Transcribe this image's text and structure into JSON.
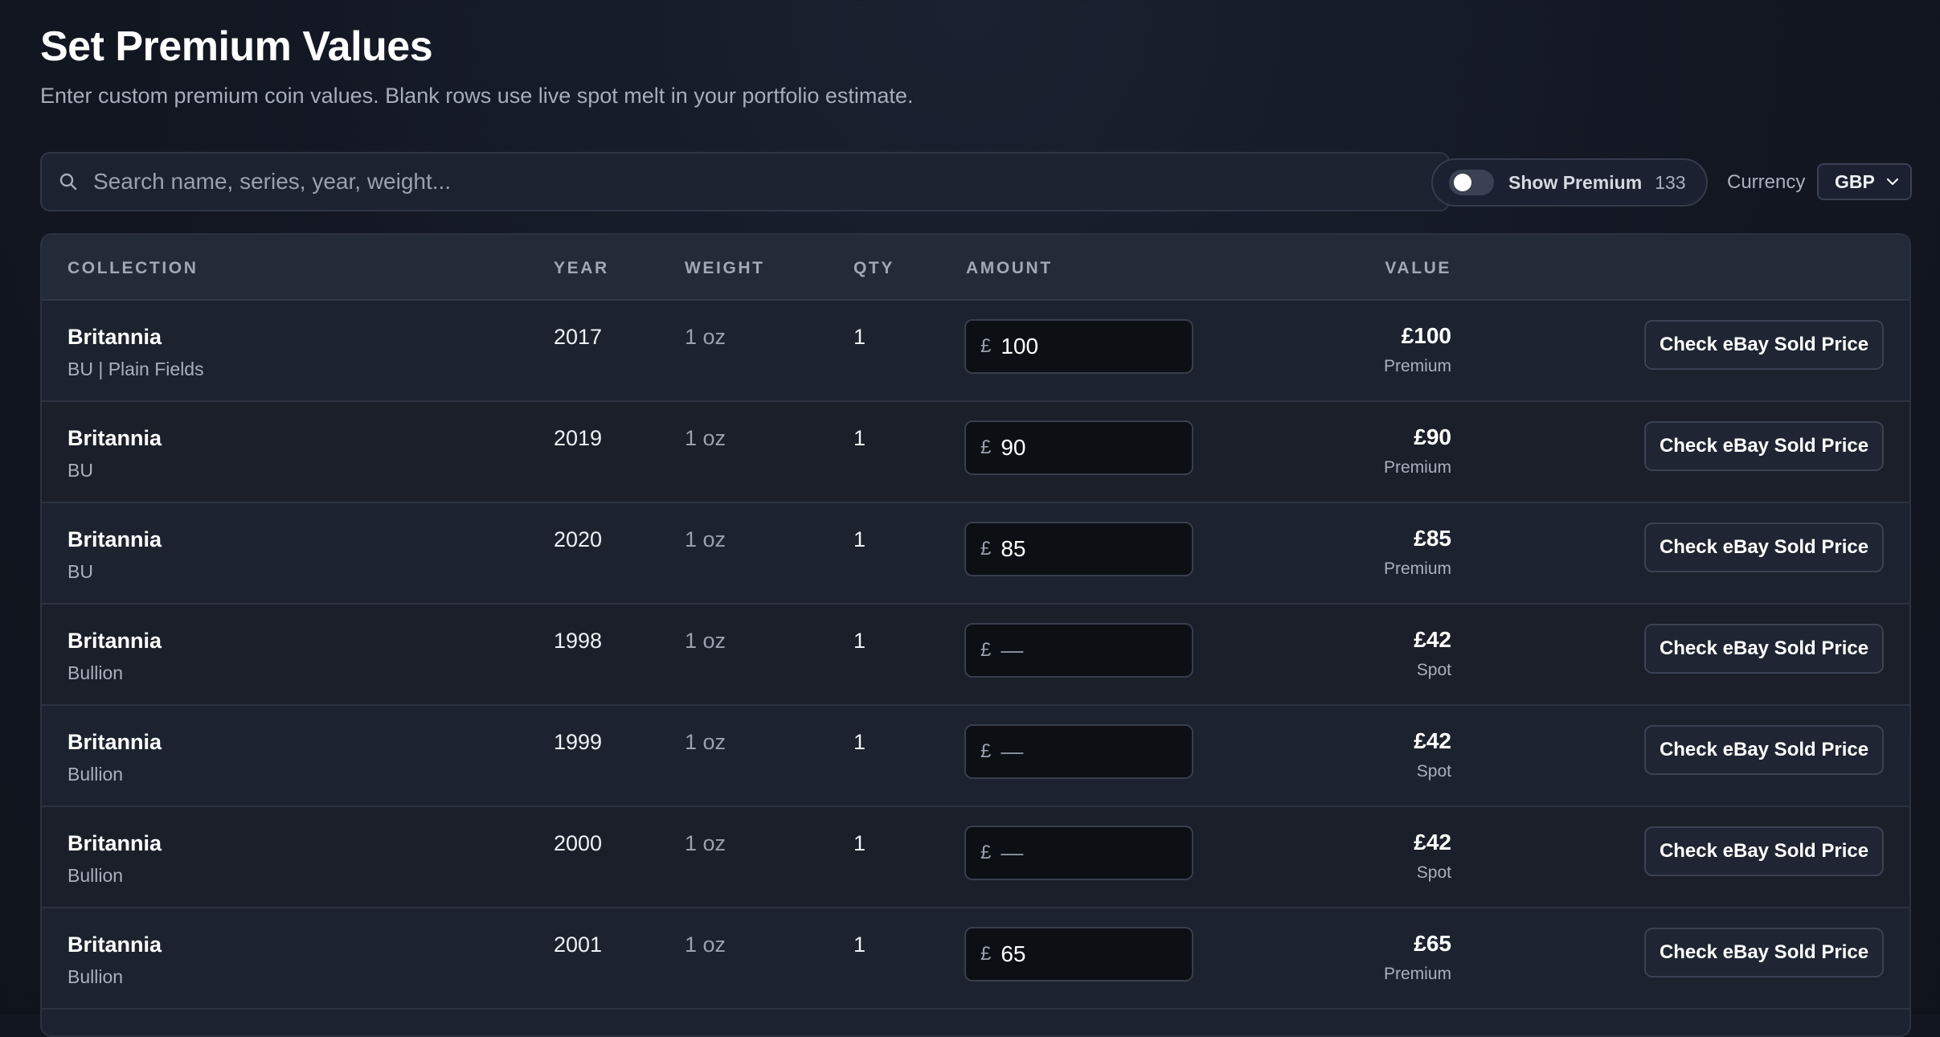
{
  "header": {
    "title": "Set Premium Values",
    "subtitle": "Enter custom premium coin values. Blank rows use live spot melt in your portfolio estimate."
  },
  "search": {
    "placeholder": "Search name, series, year, weight...",
    "value": "",
    "icon": "search-icon"
  },
  "filters": {
    "show_premium_label": "Show Premium",
    "show_premium_count": "133",
    "show_premium_on": false,
    "currency_label": "Currency",
    "currency_value": "GBP"
  },
  "table": {
    "columns": {
      "collection": "COLLECTION",
      "year": "YEAR",
      "weight": "WEIGHT",
      "qty": "QTY",
      "amount": "AMOUNT",
      "value": "VALUE"
    },
    "currency_symbol": "£",
    "amount_placeholder": "—",
    "rows": [
      {
        "name": "Britannia",
        "series": "BU | Plain Fields",
        "year": "2017",
        "weight": "1 oz",
        "qty": "1",
        "amount": "100",
        "value": "£100",
        "value_type": "Premium",
        "action": "Check eBay Sold Price"
      },
      {
        "name": "Britannia",
        "series": "BU",
        "year": "2019",
        "weight": "1 oz",
        "qty": "1",
        "amount": "90",
        "value": "£90",
        "value_type": "Premium",
        "action": "Check eBay Sold Price"
      },
      {
        "name": "Britannia",
        "series": "BU",
        "year": "2020",
        "weight": "1 oz",
        "qty": "1",
        "amount": "85",
        "value": "£85",
        "value_type": "Premium",
        "action": "Check eBay Sold Price"
      },
      {
        "name": "Britannia",
        "series": "Bullion",
        "year": "1998",
        "weight": "1 oz",
        "qty": "1",
        "amount": "",
        "value": "£42",
        "value_type": "Spot",
        "action": "Check eBay Sold Price"
      },
      {
        "name": "Britannia",
        "series": "Bullion",
        "year": "1999",
        "weight": "1 oz",
        "qty": "1",
        "amount": "",
        "value": "£42",
        "value_type": "Spot",
        "action": "Check eBay Sold Price"
      },
      {
        "name": "Britannia",
        "series": "Bullion",
        "year": "2000",
        "weight": "1 oz",
        "qty": "1",
        "amount": "",
        "value": "£42",
        "value_type": "Spot",
        "action": "Check eBay Sold Price"
      },
      {
        "name": "Britannia",
        "series": "Bullion",
        "year": "2001",
        "weight": "1 oz",
        "qty": "1",
        "amount": "65",
        "value": "£65",
        "value_type": "Premium",
        "action": "Check eBay Sold Price"
      }
    ]
  }
}
